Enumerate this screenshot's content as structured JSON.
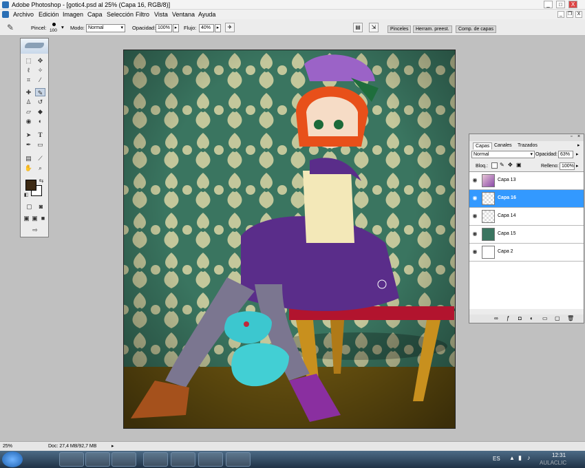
{
  "window": {
    "title": "Adobe Photoshop - [gotic4.psd al 25% (Capa 16, RGB/8)]",
    "min": "_",
    "max": "□",
    "close": "X",
    "doc_min": "_",
    "doc_restore": "❐",
    "doc_close": "X"
  },
  "menu": [
    "Archivo",
    "Edición",
    "Imagen",
    "Capa",
    "Selección",
    "Filtro",
    "Vista",
    "Ventana",
    "Ayuda"
  ],
  "options": {
    "pincel_label": "Pincel:",
    "brush_size": "100",
    "modo_label": "Modo:",
    "modo_value": "Normal",
    "opacidad_label": "Opacidad:",
    "opacidad_value": "100%",
    "flujo_label": "Flujo:",
    "flujo_value": "40%"
  },
  "panel_tabs": [
    "Pinceles",
    "Herram. preest.",
    "Comp. de capas"
  ],
  "layers_panel": {
    "tabs": [
      "Capas",
      "Canales",
      "Trazados"
    ],
    "blend_mode": "Normal",
    "opacity_label": "Opacidad:",
    "opacity_value": "63%",
    "lock_label": "Bloq.:",
    "fill_label": "Relleno:",
    "fill_value": "100%",
    "layers": [
      {
        "name": "Capa 13",
        "selected": false
      },
      {
        "name": "Capa 16",
        "selected": true
      },
      {
        "name": "Capa 14",
        "selected": false
      },
      {
        "name": "Capa 15",
        "selected": false
      },
      {
        "name": "Capa 2",
        "selected": false
      }
    ]
  },
  "status": {
    "zoom": "25%",
    "doc_info": "Doc: 27,4 MB/92,7 MB"
  },
  "taskbar": {
    "language": "ES",
    "time": "12:31",
    "watermark": "AULACLIC"
  },
  "colors": {
    "selected_layer": "#3399ff",
    "foreground_swatch": "#3d2a14",
    "background_swatch": "#ffffff"
  }
}
